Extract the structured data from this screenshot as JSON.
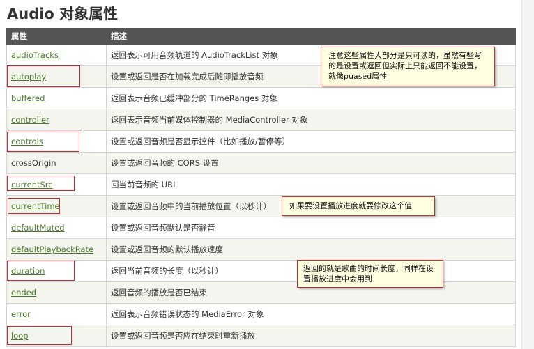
{
  "title": "Audio 对象属性",
  "table": {
    "headers": [
      "属性",
      "描述"
    ],
    "rows": [
      {
        "property": "audioTracks",
        "description": "返回表示可用音频轨道的 AudioTrackList 对象",
        "link": true
      },
      {
        "property": "autoplay",
        "description": "设置或返回是否在加载完成后随即播放音频",
        "link": true
      },
      {
        "property": "buffered",
        "description": "返回表示音频已缓冲部分的 TimeRanges 对象",
        "link": true
      },
      {
        "property": "controller",
        "description": "返回表示音频当前媒体控制器的 MediaController 对象",
        "link": true
      },
      {
        "property": "controls",
        "description": "设置或返回音频是否显示控件（比如播放/暂停等）",
        "link": true
      },
      {
        "property": "crossOrigin",
        "description": "设置或返回音频的 CORS 设置",
        "link": false
      },
      {
        "property": "currentSrc",
        "description": "回当前音频的 URL",
        "link": true
      },
      {
        "property": "currentTime",
        "description": "设置或返回音频中的当前播放位置（以秒计）",
        "link": true
      },
      {
        "property": "defaultMuted",
        "description": "设置或返回音频默认是否静音",
        "link": true
      },
      {
        "property": "defaultPlaybackRate",
        "description": "设置或返回音频的默认播放速度",
        "link": true
      },
      {
        "property": "duration",
        "description": "返回当前音频的长度（以秒计）",
        "link": true
      },
      {
        "property": "ended",
        "description": "返回音频的播放是否已结束",
        "link": true
      },
      {
        "property": "error",
        "description": "返回表示音频错误状态的 MediaError 对象",
        "link": true
      },
      {
        "property": "loop",
        "description": "设置或返回音频是否应在结束时重新播放",
        "link": true
      }
    ]
  },
  "notes": {
    "note1": "注意这些属性大部分是只可读的，虽然有些写的是设置或返回但实际上只能返回不能设置，就像puased属性",
    "note2": "如果要设置播放进度就要修改这个值",
    "note3": "返回的就是歌曲的时间长度，同样在设置播放进度中会用到"
  },
  "colors": {
    "header_bg": "#555555",
    "link": "#4a7a2c",
    "highlight_border": "#d8212a",
    "note_bg": "#ffffe1"
  }
}
